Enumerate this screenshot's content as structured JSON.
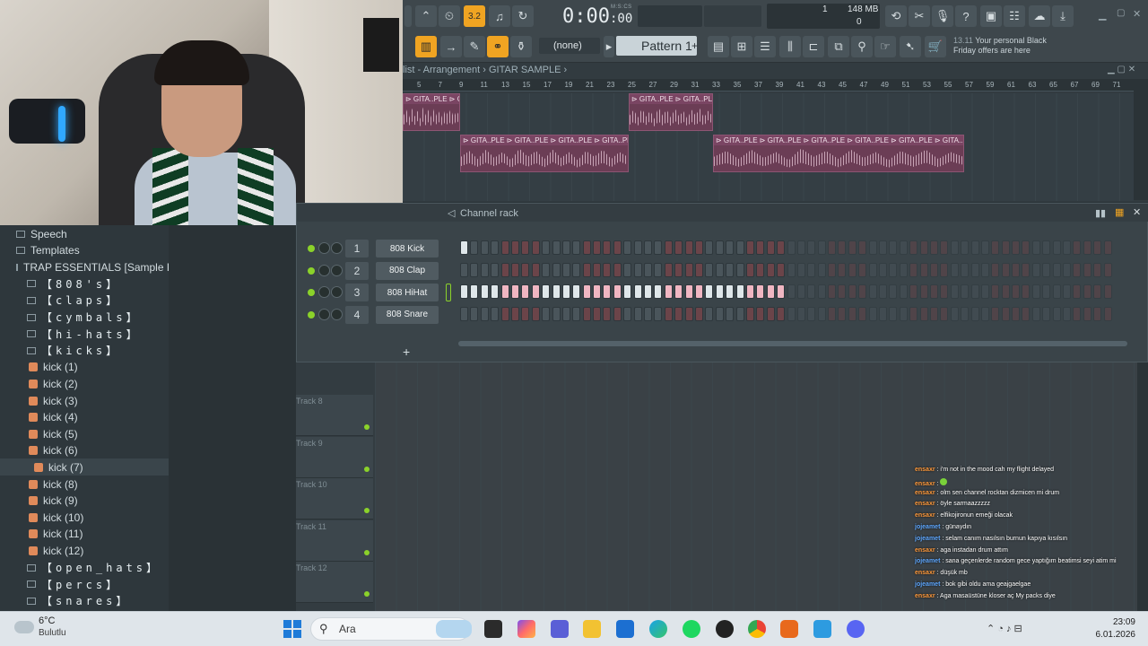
{
  "toolbar": {
    "time_main": "0:00",
    "time_sub": "00",
    "time_unit": "M:S:CS",
    "cpu": "1",
    "memory": "148 MB",
    "polyphony": "0",
    "snap": "(none)",
    "pattern": "Pattern 1",
    "news_time": "13.11",
    "news_text": "Your personal Black",
    "news_text2": "Friday offers are here"
  },
  "playlist": {
    "title": "list - Arrangement  ›  GITAR SAMPLE  ›",
    "ruler": [
      "5",
      "7",
      "9",
      "11",
      "13",
      "15",
      "17",
      "19",
      "21",
      "23",
      "25",
      "27",
      "29",
      "31",
      "33",
      "35",
      "37",
      "39",
      "41",
      "43",
      "45",
      "47",
      "49",
      "51",
      "53",
      "55",
      "57",
      "59",
      "61",
      "63",
      "65",
      "67",
      "69",
      "71"
    ],
    "clip_label_a": "⊳ GITA..PLE ⊳ GITA..PLE",
    "clip_label_b": "⊳ GITA..PLE ⊳ GITA..PLE ⊳ GITA..PLE ⊳ GITA..PLE",
    "clip_label_c": "⊳ GITA..PLE ⊳ GITA..PLE ⊳ GITA..PLE ⊳ GITA..PLE ⊳ GITA..PLE ⊳ GITA..PLE"
  },
  "browser": {
    "items": [
      {
        "label": "Speech",
        "type": "folder"
      },
      {
        "label": "Templates",
        "type": "folder"
      },
      {
        "label": "TRAP ESSENTIALS [Sample Pack]",
        "type": "folder"
      },
      {
        "label": "【808's】",
        "type": "sub"
      },
      {
        "label": "【claps】",
        "type": "sub"
      },
      {
        "label": "【cymbals】",
        "type": "sub"
      },
      {
        "label": "【hi-hats】",
        "type": "sub"
      },
      {
        "label": "【kicks】",
        "type": "sub"
      },
      {
        "label": "kick (1)",
        "type": "file"
      },
      {
        "label": "kick (2)",
        "type": "file"
      },
      {
        "label": "kick (3)",
        "type": "file"
      },
      {
        "label": "kick (4)",
        "type": "file"
      },
      {
        "label": "kick (5)",
        "type": "file"
      },
      {
        "label": "kick (6)",
        "type": "file"
      },
      {
        "label": "kick (7)",
        "type": "file"
      },
      {
        "label": "kick (8)",
        "type": "file"
      },
      {
        "label": "kick (9)",
        "type": "file"
      },
      {
        "label": "kick (10)",
        "type": "file"
      },
      {
        "label": "kick (11)",
        "type": "file"
      },
      {
        "label": "kick (12)",
        "type": "file"
      },
      {
        "label": "【open_hats】",
        "type": "sub"
      },
      {
        "label": "【percs】",
        "type": "sub"
      },
      {
        "label": "【snares】",
        "type": "sub"
      }
    ]
  },
  "rack": {
    "title": "Channel rack",
    "channels": [
      {
        "num": "1",
        "name": "808 Kick",
        "on": [
          0
        ]
      },
      {
        "num": "2",
        "name": "808 Clap",
        "on": []
      },
      {
        "num": "3",
        "name": "808 HiHat",
        "on": [
          0,
          1,
          2,
          3,
          4,
          5,
          6,
          7,
          8,
          9,
          10,
          11,
          12,
          13,
          14,
          15,
          16,
          17,
          18,
          19,
          20,
          21,
          22,
          23,
          24,
          25,
          26,
          27,
          28,
          29,
          30,
          31
        ]
      },
      {
        "num": "4",
        "name": "808 Snare",
        "on": []
      }
    ]
  },
  "tracks": [
    "Track 8",
    "Track 9",
    "Track 10",
    "Track 11",
    "Track 12"
  ],
  "chat": [
    {
      "user": "ensaxr",
      "msg": "i'm not in the mood cah my flight delayed",
      "color": "#ff9a3c"
    },
    {
      "user": "ensaxr",
      "msg": "",
      "color": "#ff9a3c"
    },
    {
      "user": "ensaxr",
      "msg": "olm sen channel rocktan dizmicen mi drum",
      "color": "#ff9a3c"
    },
    {
      "user": "ensaxr",
      "msg": "öyle sarmaazzzzz",
      "color": "#ff9a3c"
    },
    {
      "user": "ensaxr",
      "msg": "elfikojironun emeği olacak",
      "color": "#ff9a3c"
    },
    {
      "user": "jojeamet",
      "msg": "günaydın",
      "color": "#5fa8ff"
    },
    {
      "user": "jojeamet",
      "msg": "selam canım nasılsın burnun kapıya kısılsın",
      "color": "#5fa8ff"
    },
    {
      "user": "ensaxr",
      "msg": "aga instadan drum attım",
      "color": "#ff9a3c"
    },
    {
      "user": "jojeamet",
      "msg": "sana geçenlerde random gece yaptığım beatimsi seyi atim mi",
      "color": "#5fa8ff"
    },
    {
      "user": "ensaxr",
      "msg": "düşük mb",
      "color": "#ff9a3c"
    },
    {
      "user": "jojeamet",
      "msg": "bok gibi oldu ama geajgaelgae",
      "color": "#5fa8ff"
    },
    {
      "user": "ensaxr",
      "msg": "Aga masaüstüne kloser aç My packs diye",
      "color": "#ff9a3c"
    }
  ],
  "taskbar": {
    "temp": "6°C",
    "weather": "Bulutlu",
    "search": "Ara",
    "time": "23:09",
    "date": "6.01.2026"
  },
  "colors": {
    "accent": "#f0a422",
    "led": "#8bd22a",
    "clip": "#6b3d55"
  }
}
